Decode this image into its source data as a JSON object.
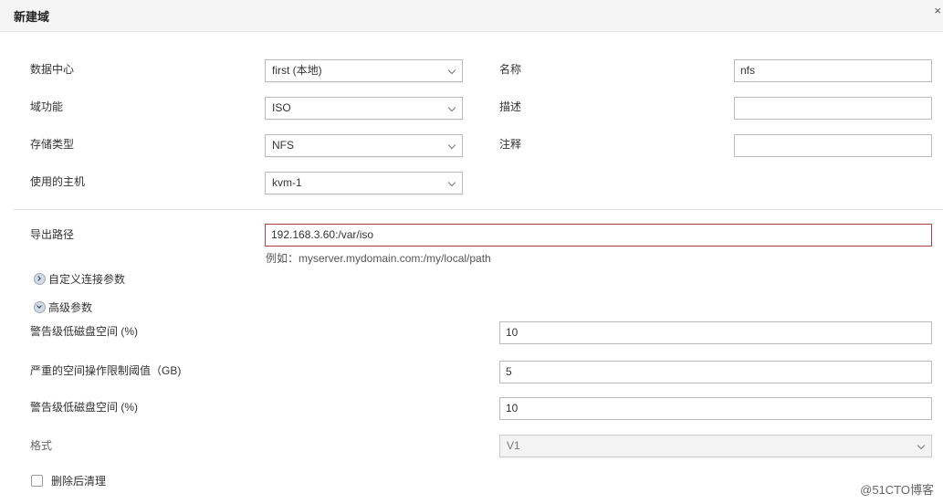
{
  "dialog": {
    "title": "新建域",
    "close_icon": "×"
  },
  "form": {
    "datacenter": {
      "label": "数据中心",
      "value": "first (本地)"
    },
    "domain_function": {
      "label": "域功能",
      "value": "ISO"
    },
    "storage_type": {
      "label": "存储类型",
      "value": "NFS"
    },
    "host": {
      "label": "使用的主机",
      "value": "kvm-1"
    },
    "name": {
      "label": "名称",
      "value": "nfs"
    },
    "description": {
      "label": "描述",
      "value": ""
    },
    "comment": {
      "label": "注释",
      "value": ""
    },
    "export_path": {
      "label": "导出路径",
      "value": "192.168.3.60:/var/iso",
      "hint": "例如：myserver.mydomain.com:/my/local/path"
    }
  },
  "sections": {
    "custom_connection": {
      "label": "自定义连接参数",
      "icon": "expand-right-icon"
    },
    "advanced": {
      "label": "高级参数",
      "icon": "collapse-down-icon"
    }
  },
  "advanced": {
    "warning_low_space": {
      "label": "警告级低磁盘空间 (%)",
      "value": "10"
    },
    "critical_space": {
      "label": "严重的空间操作限制阈值（GB)",
      "value": "5"
    },
    "warning_low_space_2": {
      "label": "警告级低磁盘空间 (%)",
      "value": "10"
    },
    "format": {
      "label": "格式",
      "value": "V1"
    },
    "wipe_after_delete": {
      "label": "删除后清理",
      "checked": false
    }
  },
  "watermark": "@51CTO博客"
}
